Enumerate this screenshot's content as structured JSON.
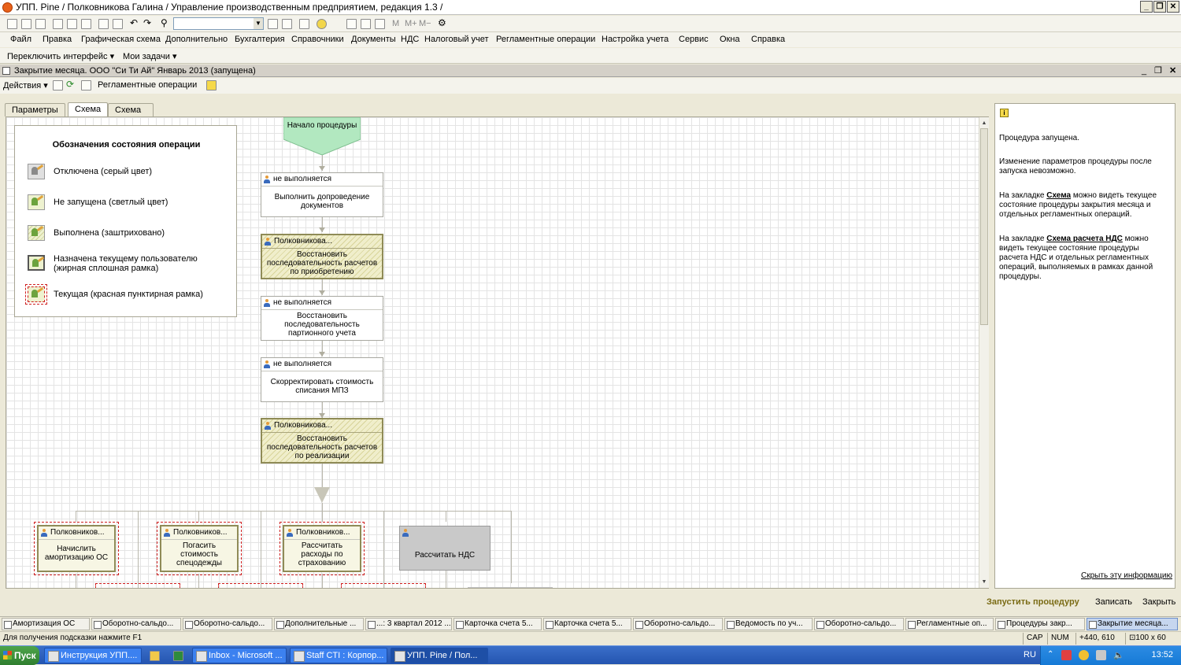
{
  "window": {
    "title": "УПП. Pine / Полковникова Галина /  Управление производственным предприятием, редакция 1.3 /"
  },
  "menu": {
    "items": [
      "Файл",
      "Правка",
      "Графическая схема",
      "Дополнительно",
      "Бухгалтерия",
      "Справочники",
      "Документы",
      "НДС",
      "Налоговый учет",
      "Регламентные операции",
      "Настройка учета",
      "Сервис",
      "Окна",
      "Справка"
    ],
    "switch_interface": "Переключить интерфейс",
    "my_tasks": "Мои задачи"
  },
  "toolbar_icons": [
    "new-icon",
    "open-icon",
    "save-icon",
    "cut-icon",
    "copy-icon",
    "paste-icon",
    "print-icon",
    "preview-icon",
    "undo-icon",
    "redo-icon",
    "search-icon",
    "refresh-icon",
    "calc-icon",
    "memory-icon"
  ],
  "toolbar_text": {
    "m": "M",
    "mplus": "M+",
    "mminus": "M−"
  },
  "document": {
    "title": "Закрытие месяца. ООО \"Си Ти Ай\" Январь 2013 (запущена)",
    "actions_label": "Действия",
    "reg_ops_label": "Регламентные операции"
  },
  "tabs": [
    {
      "label": "Параметры",
      "active": false
    },
    {
      "label": "Схема",
      "active": true
    },
    {
      "label": "Схема расчета НДС",
      "active": false
    }
  ],
  "legend": {
    "title": "Обозначения состояния операции",
    "items": [
      {
        "label": "Отключена (серый цвет)"
      },
      {
        "label": "Не запущена (светлый цвет)"
      },
      {
        "label": "Выполнена (заштриховано)"
      },
      {
        "label": "Назначена текущему пользователю (жирная сплошная рамка)"
      },
      {
        "label": "Текущая (красная пунктирная рамка)"
      }
    ]
  },
  "flow": {
    "start": "Начало процедуры",
    "nodes": [
      {
        "header": "не выполняется",
        "body": "Выполнить допроведение документов"
      },
      {
        "header": "Полковникова...",
        "body": "Восстановить последовательность расчетов по приобретению"
      },
      {
        "header": "не выполняется",
        "body": "Восстановить последовательность партионного учета"
      },
      {
        "header": "не выполняется",
        "body": "Скорректировать стоимость списания МПЗ"
      },
      {
        "header": "Полковникова...",
        "body": "Восстановить последовательность расчетов по реализации"
      },
      {
        "header": "Полковников...",
        "body": "Начислить амортизацию ОС"
      },
      {
        "header": "Полковников...",
        "body": "Погасить стоимость спецодежды"
      },
      {
        "header": "Полковников...",
        "body": "Рассчитать расходы по страхованию"
      },
      {
        "header": "",
        "body": "Рассчитать НДС"
      }
    ]
  },
  "info": {
    "p1": "Процедура запущена.",
    "p2": "Изменение параметров процедуры после запуска невозможно.",
    "p3_pre": "На закладке ",
    "p3_link": "Схема",
    "p3_post": " можно видеть текущее состояние процедуры закрытия месяца и отдельных регламентных операций.",
    "p4_pre": "На закладке ",
    "p4_link": "Схема расчета НДС",
    "p4_post": " можно видеть текущее состояние процедуры расчета НДС и отдельных регламентных операций, выполняемых в рамках данной процедуры.",
    "hide_link": "Скрыть эту информацию"
  },
  "bottom_commands": {
    "run": "Запустить процедуру",
    "save": "Записать",
    "close": "Закрыть"
  },
  "window_tasks": [
    "Амортизация ОС",
    "Оборотно-сальдо...",
    "Оборотно-сальдо...",
    "Дополнительные ...",
    "...: 3 квартал 2012 ...",
    "Карточка счета 5...",
    "Карточка счета 5...",
    "Оборотно-сальдо...",
    "Ведомость по уч...",
    "Оборотно-сальдо...",
    "Регламентные оп...",
    "Процедуры закр...",
    "Закрытие месяца..."
  ],
  "status": {
    "hint": "Для получения подсказки нажмите F1",
    "cap": "CAP",
    "num": "NUM",
    "coords": "440, 610",
    "size": "100 x 60"
  },
  "taskbar": {
    "start": "Пуск",
    "tasks": [
      "Инструкция УПП....",
      "Inbox - Microsoft ...",
      "Staff CTI : Корпор...",
      "УПП. Pine / Пол..."
    ],
    "lang": "RU",
    "clock": "13:52"
  }
}
